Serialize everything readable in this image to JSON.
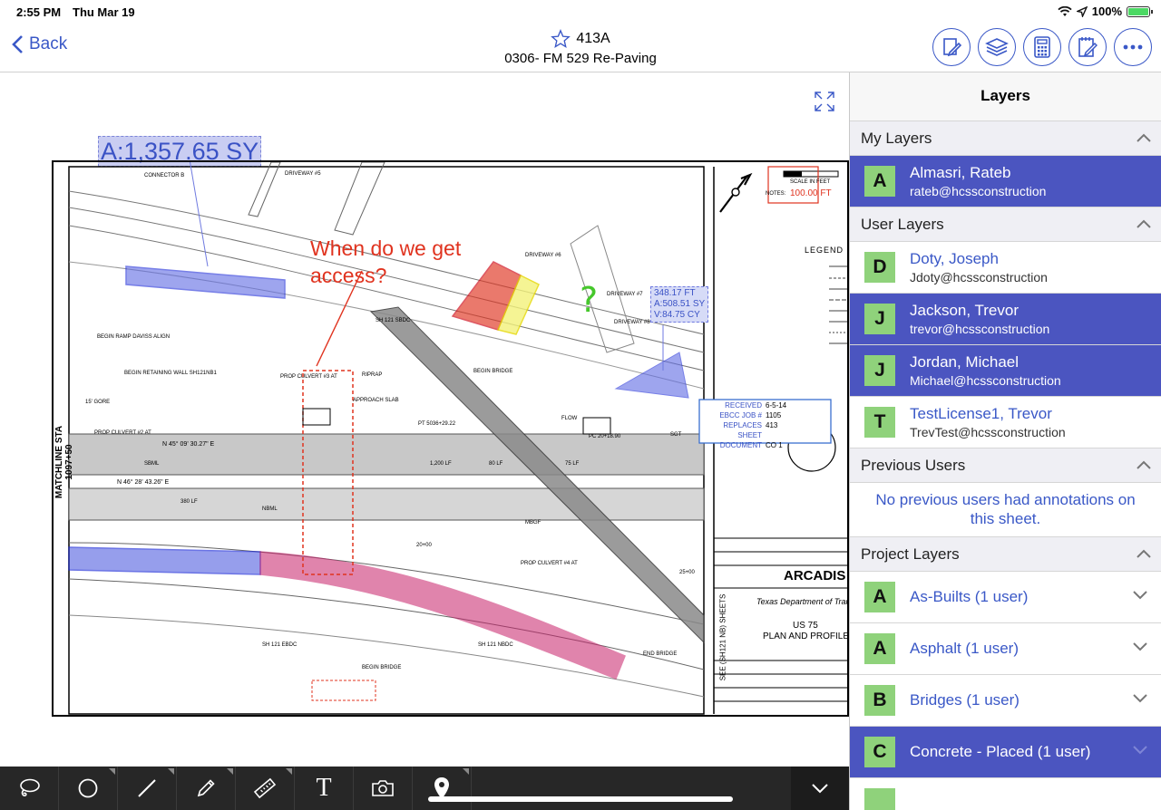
{
  "status_bar": {
    "time": "2:55 PM",
    "date": "Thu Mar 19",
    "battery": "100%",
    "battery_level": 1.0
  },
  "nav": {
    "back_label": "Back",
    "sheet_number": "413A",
    "sheet_title": "0306- FM 529 Re-Paving",
    "actions": [
      "edit-sheet-icon",
      "layers-icon",
      "calculator-icon",
      "notes-icon",
      "more-icon"
    ]
  },
  "drawing": {
    "area_measure": "A:1,357.65 SY",
    "callout_text": "When do we get access?",
    "measure_box": [
      "348.17 FT",
      "A:508.51 SY",
      "V:84.75 CY"
    ],
    "scale_note": "100.00 FT",
    "matchline_left": "MATCHLINE STA 1097+50",
    "matchline_right": "SEE (SH121 NB) SHEETS",
    "logo": "ARCADIS",
    "dot_name": "Texas Department of Tran",
    "plan_title": "PLAN AND PROFILE",
    "route": "US 75",
    "stamp": [
      {
        "label": "RECEIVED",
        "value": "6-5-14"
      },
      {
        "label": "EBCC JOB #",
        "value": "1105"
      },
      {
        "label": "REPLACES SHEET",
        "value": "413"
      },
      {
        "label": "DOCUMENT",
        "value": "CO 1"
      }
    ],
    "labels": [
      "CONNECTOR B",
      "DRIVEWAY #5",
      "DRIVEWAY #6",
      "DRIVEWAY #7",
      "DRIVEWAY #8",
      "SH 121 SBDC",
      "BEGIN BRIDGE",
      "BEGIN RAMP DAVISS ALIGN",
      "BEGIN RETAINING WALL SH121NB1",
      "PROP CULVERT #3 AT",
      "APPROACH SLAB",
      "RIPRAP",
      "FLOW",
      "PT 5036+29.22",
      "PC 20+18.90",
      "N 45° 09' 30.27\" E",
      "N 46° 28' 43.26\" E",
      "PROP CULVERT #2 AT",
      "15' GORE",
      "380 LF",
      "1,200 LF",
      "80 LF",
      "75 LF",
      "SGT",
      "SH 121 EBDC",
      "SH 121 NBDC",
      "BEGIN BRIDGE",
      "END BRIDGE",
      "MBGF",
      "NBML",
      "SBML",
      "PROP CULVERT #4 AT",
      "20+00",
      "25+00",
      "LEGEND",
      "SCALE IN FEET",
      "NOTES:"
    ]
  },
  "toolbar": {
    "tools": [
      "lasso-icon",
      "circle-icon",
      "line-icon",
      "pencil-icon",
      "ruler-icon",
      "text-icon",
      "camera-icon",
      "location-pin-icon"
    ],
    "text_tool_glyph": "T",
    "collapse": "chevron-down-icon"
  },
  "panel": {
    "title": "Layers",
    "my_layers": {
      "header": "My Layers",
      "rows": [
        {
          "initial": "A",
          "name": "Almasri, Rateb",
          "email": "rateb@hcssconstruction",
          "selected": true
        }
      ]
    },
    "user_layers": {
      "header": "User Layers",
      "rows": [
        {
          "initial": "D",
          "name": "Doty, Joseph",
          "email": "Jdoty@hcssconstruction",
          "selected": false
        },
        {
          "initial": "J",
          "name": "Jackson, Trevor",
          "email": "trevor@hcssconstruction",
          "selected": true
        },
        {
          "initial": "J",
          "name": "Jordan, Michael",
          "email": "Michael@hcssconstruction",
          "selected": true
        },
        {
          "initial": "T",
          "name": "TestLicense1, Trevor",
          "email": "TrevTest@hcssconstruction",
          "selected": false
        }
      ]
    },
    "previous_users": {
      "header": "Previous Users",
      "note": "No previous users had annotations on this sheet."
    },
    "project_layers": {
      "header": "Project Layers",
      "rows": [
        {
          "initial": "A",
          "name": "As-Builts (1 user)",
          "selected": false
        },
        {
          "initial": "A",
          "name": "Asphalt (1 user)",
          "selected": false
        },
        {
          "initial": "B",
          "name": "Bridges (1 user)",
          "selected": false
        },
        {
          "initial": "C",
          "name": "Concrete - Placed (1 user)",
          "selected": true
        }
      ]
    }
  },
  "colors": {
    "accent": "#3a58c7",
    "selected_row": "#4b55c0",
    "avatar": "#8fd27b",
    "markup_red": "#e0331f",
    "markup_blue": "#2c3cc8",
    "markup_pink": "#c8206a"
  }
}
